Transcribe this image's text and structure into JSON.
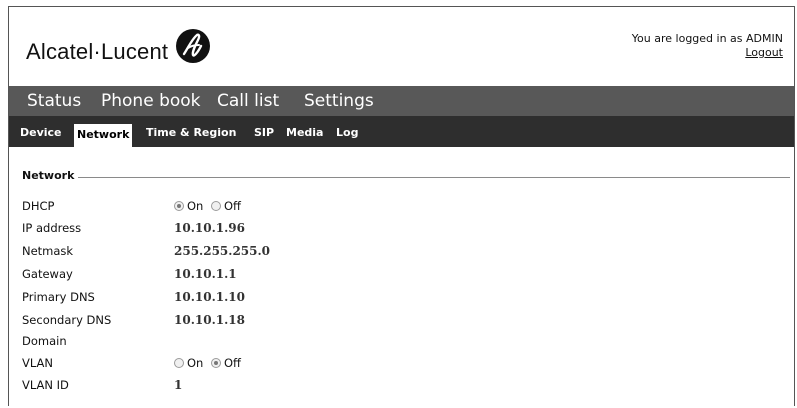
{
  "header": {
    "brand": "Alcatel·Lucent",
    "logo_icon": "alcatel-lucent-logo-icon",
    "login_text": "You are logged in as ADMIN",
    "logout_label": "Logout"
  },
  "main_nav": {
    "items": [
      {
        "label": "Status"
      },
      {
        "label": "Phone book"
      },
      {
        "label": "Call list"
      },
      {
        "label": "Settings"
      }
    ]
  },
  "sub_nav": {
    "active": "Network",
    "items": [
      {
        "label": "Device"
      },
      {
        "label": "Network"
      },
      {
        "label": "Time & Region"
      },
      {
        "label": "SIP"
      },
      {
        "label": "Media"
      },
      {
        "label": "Log"
      }
    ]
  },
  "network": {
    "section_title": "Network",
    "dhcp": {
      "label": "DHCP",
      "on_label": "On",
      "off_label": "Off",
      "selected": "On"
    },
    "ip_address": {
      "label": "IP address",
      "value": "10.10.1.96"
    },
    "netmask": {
      "label": "Netmask",
      "value": "255.255.255.0"
    },
    "gateway": {
      "label": "Gateway",
      "value": "10.10.1.1"
    },
    "primary_dns": {
      "label": "Primary DNS",
      "value": "10.10.1.10"
    },
    "secondary_dns": {
      "label": "Secondary DNS",
      "value": "10.10.1.18"
    },
    "domain": {
      "label": "Domain",
      "value": ""
    },
    "vlan": {
      "label": "VLAN",
      "on_label": "On",
      "off_label": "Off",
      "selected": "Off"
    },
    "vlan_id": {
      "label": "VLAN ID",
      "value": "1"
    }
  },
  "colors": {
    "main_nav_bg": "#585858",
    "sub_nav_bg": "#2e2e2e",
    "active_tab_bg": "#ffffff"
  }
}
